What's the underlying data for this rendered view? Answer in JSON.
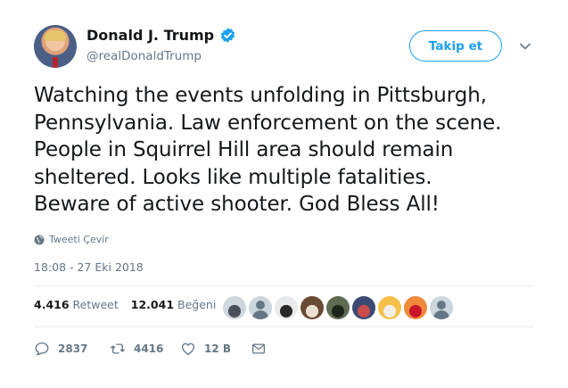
{
  "author": {
    "display_name": "Donald J. Trump",
    "handle": "@realDonaldTrump",
    "verified": true
  },
  "header": {
    "follow_label": "Takip et",
    "caret_icon": "chevron-down-icon"
  },
  "tweet": {
    "lines": [
      "Watching the events unfolding in Pittsburgh,",
      "Pennsylvania. Law enforcement on the scene.",
      "People in Squirrel Hill area should remain",
      "sheltered. Looks like multiple fatalities.",
      "Beware of active shooter. God Bless All!"
    ],
    "translate_label": "Tweeti Çevir",
    "timestamp": "18:08 - 27 Eki 2018"
  },
  "stats": {
    "retweets_value": "4.416",
    "retweets_label": "Retweet",
    "likes_value": "12.041",
    "likes_label": "Beğeni"
  },
  "likers": [
    {
      "kind": "photo",
      "colors": [
        "#cfd6de",
        "#4a4f58"
      ]
    },
    {
      "kind": "default"
    },
    {
      "kind": "photo",
      "colors": [
        "#e9eaec",
        "#2a2a2a"
      ]
    },
    {
      "kind": "photo",
      "colors": [
        "#6b4a33",
        "#e9e1d3"
      ]
    },
    {
      "kind": "photo",
      "colors": [
        "#5f6b52",
        "#1f2418"
      ]
    },
    {
      "kind": "photo",
      "colors": [
        "#3b4a73",
        "#c94b4b"
      ]
    },
    {
      "kind": "photo",
      "colors": [
        "#f5c04a",
        "#f2efe9"
      ]
    },
    {
      "kind": "photo",
      "colors": [
        "#f08a3a",
        "#c9152b"
      ]
    },
    {
      "kind": "default"
    }
  ],
  "actions": {
    "reply_count": "2837",
    "retweet_count": "4416",
    "like_count": "12 B"
  },
  "colors": {
    "accent": "#1da1f2",
    "text": "#14171a",
    "secondary": "#657786",
    "divider": "#e6ecf0"
  }
}
